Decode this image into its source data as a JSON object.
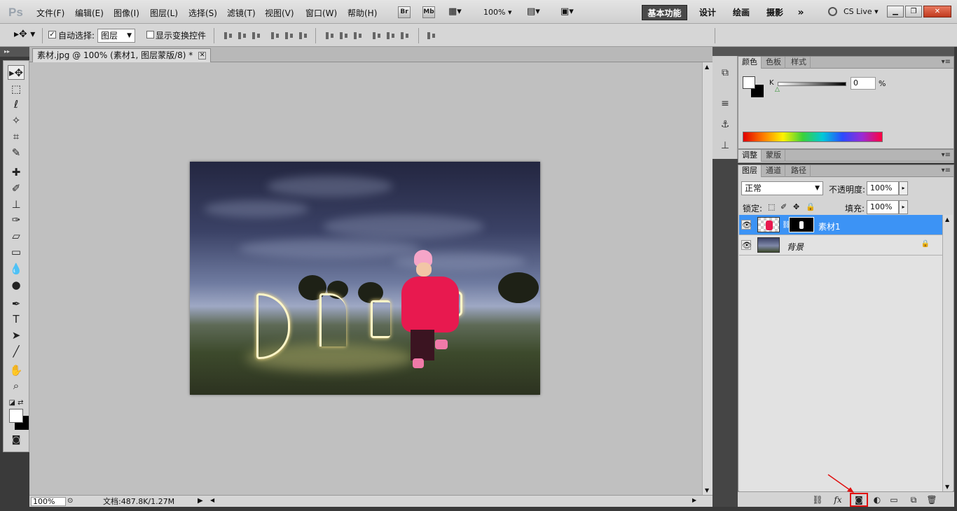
{
  "app": {
    "logo": "Ps"
  },
  "menu": [
    "文件(F)",
    "编辑(E)",
    "图像(I)",
    "图层(L)",
    "选择(S)",
    "滤镜(T)",
    "视图(V)",
    "窗口(W)",
    "帮助(H)"
  ],
  "app_bar": {
    "bridge": "Br",
    "minibridge": "Mb",
    "zoom": "100%"
  },
  "workspaces": [
    "基本功能",
    "设计",
    "绘画",
    "摄影"
  ],
  "workspace_active": "基本功能",
  "workspace_more": "»",
  "cs_live": "CS Live",
  "options_bar": {
    "auto_select_label": "自动选择:",
    "auto_select_checked": true,
    "auto_select_target": "图层",
    "show_transform_label": "显示变换控件",
    "show_transform_checked": false
  },
  "document": {
    "tab_title": "素材.jpg @ 100% (素材1, 图层蒙版/8) *",
    "zoom": "100%",
    "doc_info": "文档:487.8K/1.27M"
  },
  "photo_text": "DREAMS",
  "color_panel": {
    "tabs": [
      "颜色",
      "色板",
      "样式"
    ],
    "active_tab": "颜色",
    "channel_label": "K",
    "channel_value": "0",
    "percent": "%"
  },
  "adjust_panel": {
    "tabs": [
      "调整",
      "蒙版"
    ],
    "active_tab": "调整"
  },
  "layers_panel": {
    "tabs": [
      "图层",
      "通道",
      "路径"
    ],
    "active_tab": "图层",
    "blend_mode": "正常",
    "opacity_label": "不透明度:",
    "opacity_value": "100%",
    "lock_label": "锁定:",
    "fill_label": "填充:",
    "fill_value": "100%",
    "layers": [
      {
        "name": "素材1",
        "selected": true,
        "has_mask": true,
        "locked": false
      },
      {
        "name": "背景",
        "selected": false,
        "has_mask": false,
        "locked": true
      }
    ],
    "highlighted_button": "add-layer-mask-button"
  },
  "colors": {
    "selection_blue": "#3c93f5",
    "highlight_red": "#e01010",
    "panel_gray": "#d4d4d4",
    "canvas_gray": "#c0c0c0"
  }
}
